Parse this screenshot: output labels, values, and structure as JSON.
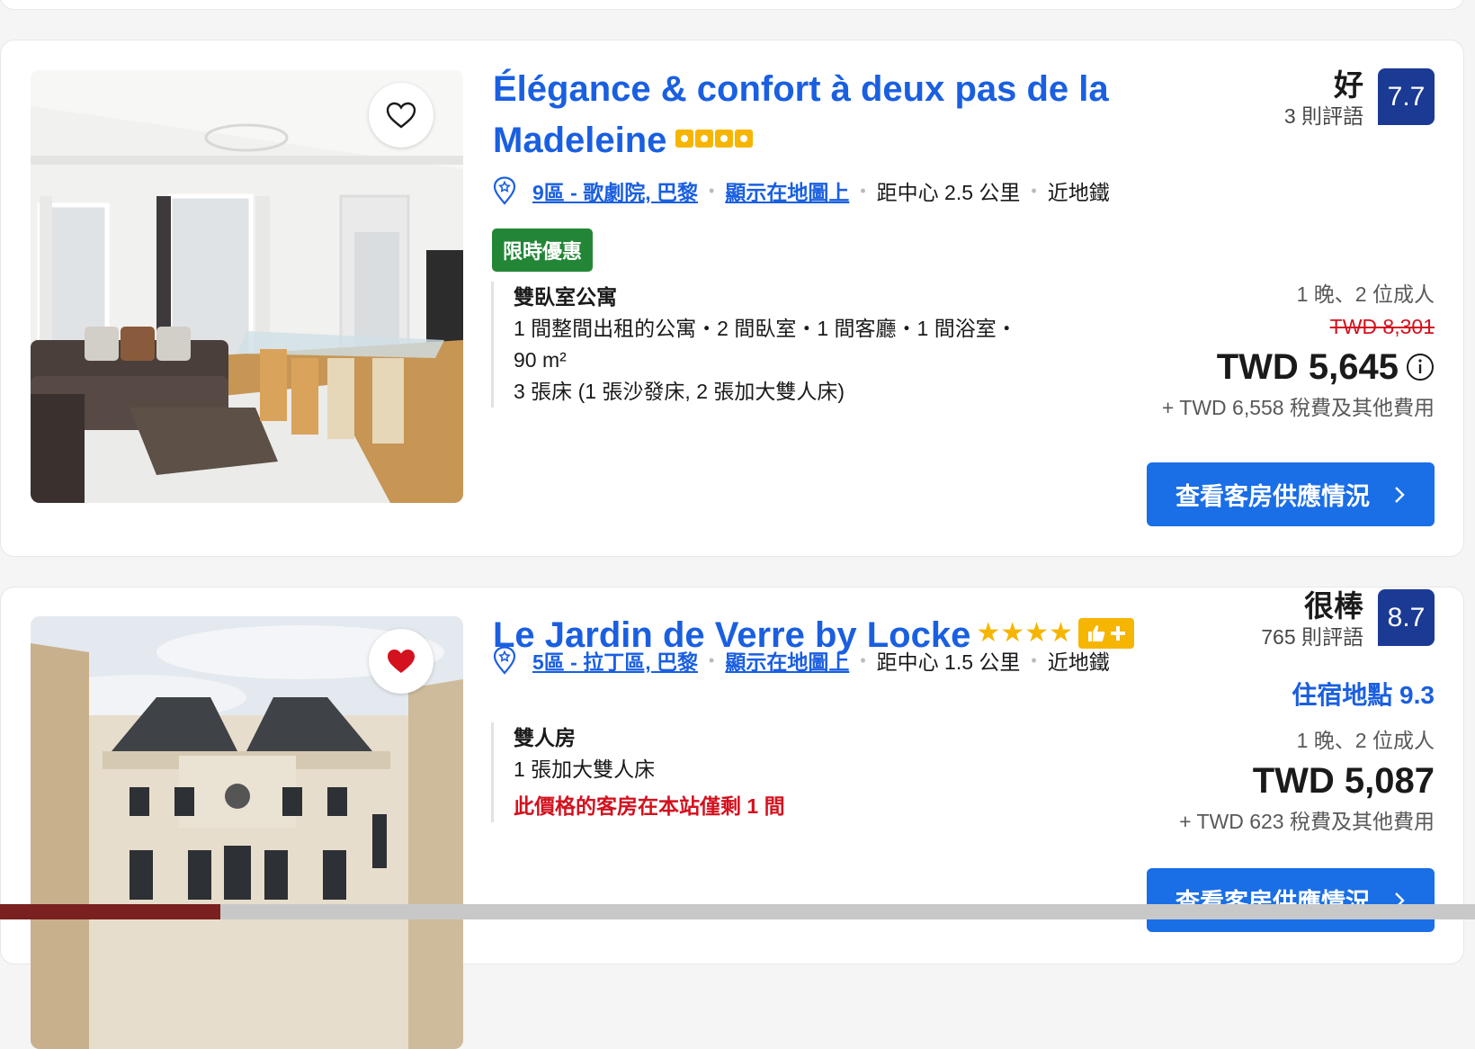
{
  "listings": [
    {
      "title": "Élégance & confort à deux pas de la Madeleine",
      "favorited": false,
      "district": "9區 - 歌劇院, 巴黎",
      "map_link": "顯示在地圖上",
      "distance": "距中心 2.5 公里",
      "transit": "近地鐵",
      "deal_badge": "限時優惠",
      "rating_word": "好",
      "review_count": "3 則評語",
      "score": "7.7",
      "room_name": "雙臥室公寓",
      "room_desc_1": "1 間整間出租的公寓・2 間臥室・1 間客廳・1 間浴室・",
      "room_desc_2": "90 m²",
      "beds": "3 張床 (1 張沙發床, 2 張加大雙人床)",
      "nights_guests": "1 晚、2 位成人",
      "original_price": "TWD 8,301",
      "price": "TWD 5,645",
      "taxes": "+ TWD 6,558 稅費及其他費用",
      "cta": "查看客房供應情況"
    },
    {
      "title": "Le Jardin de Verre by Locke",
      "stars": "★★★★",
      "favorited": true,
      "district": "5區 - 拉丁區, 巴黎",
      "map_link": "顯示在地圖上",
      "distance": "距中心 1.5 公里",
      "transit": "近地鐵",
      "rating_word": "很棒",
      "review_count": "765 則評語",
      "score": "8.7",
      "location_score": "住宿地點 9.3",
      "room_name": "雙人房",
      "beds": "1 張加大雙人床",
      "scarcity": "此價格的客房在本站僅剩 1 間",
      "nights_guests": "1 晚、2 位成人",
      "price": "TWD 5,087",
      "taxes": "+ TWD 623 稅費及其他費用",
      "cta": "查看客房供應情況"
    }
  ],
  "colors": {
    "link_blue": "#1a5fe0",
    "button_blue": "#1a6ee6",
    "score_navy": "#1b3a94",
    "deal_green": "#238636",
    "alert_red": "#d4111e",
    "star_gold": "#f6b500"
  }
}
